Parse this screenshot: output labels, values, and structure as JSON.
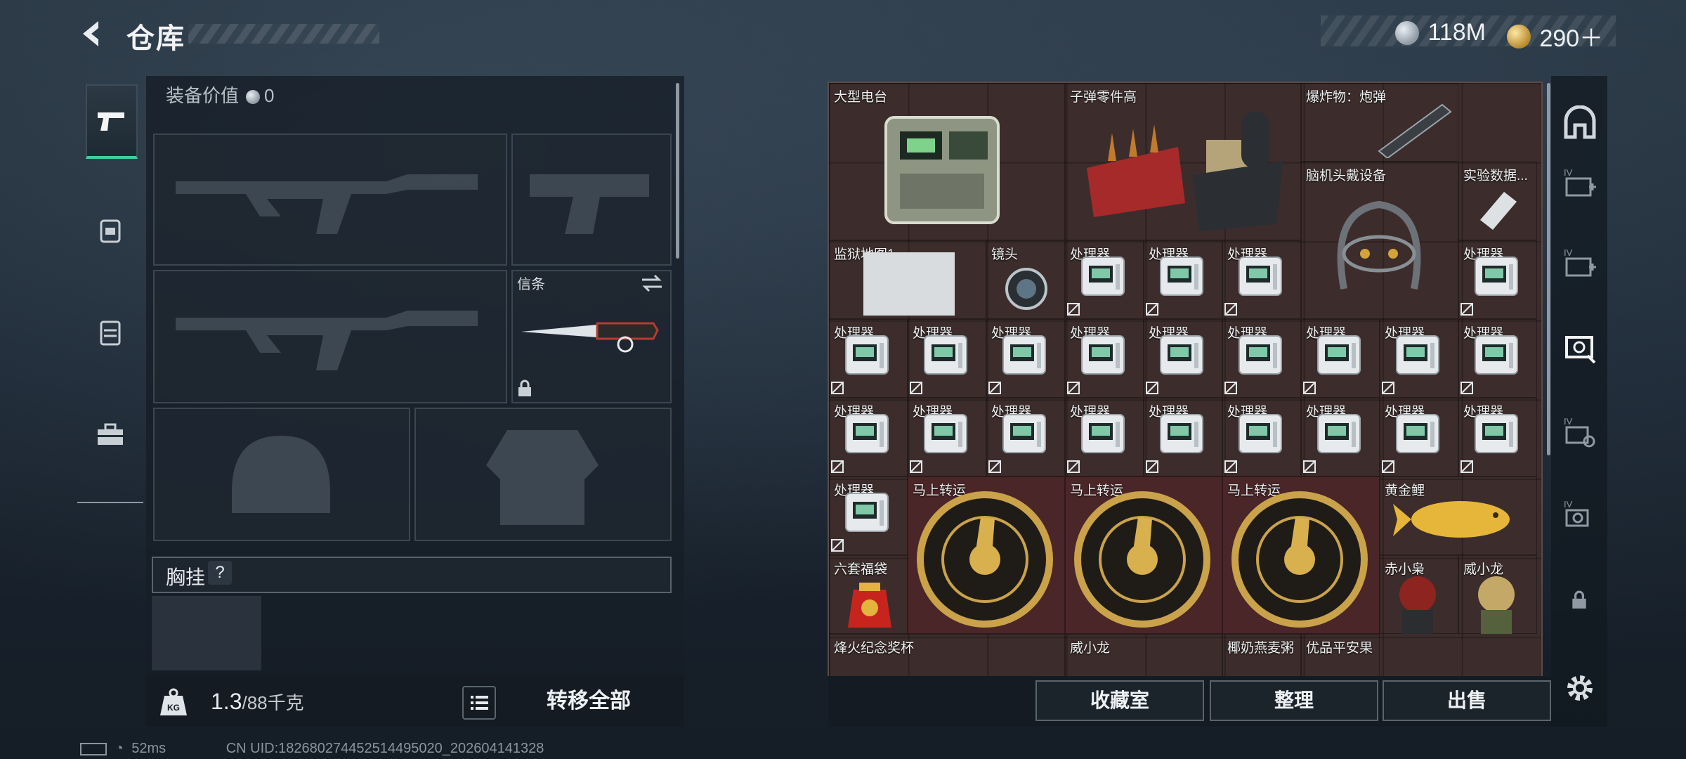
{
  "header": {
    "title": "仓库",
    "currency_silver": "118M",
    "currency_gold": "290＋"
  },
  "left_panel": {
    "equipment_value_label": "装备价值",
    "equipment_value": "0",
    "knife_slot_label": "信条",
    "chest_rig_label": "胸挂",
    "chest_rig_help": "?",
    "weight_value": "1.3",
    "weight_capacity": "/88千克",
    "transfer_all": "转移全部"
  },
  "status_bar": {
    "ping": "52ms",
    "uid": "CN UID:18268027445251449502​0_202604141328"
  },
  "grid_items": {
    "big_radio": "大型电台",
    "bullet_parts": "子弹零件高",
    "explosive": "爆炸物：炮弹",
    "brain_headset": "脑机头戴设备",
    "experiment_data": "实验数据...",
    "prison_map": "监狱地图1",
    "lens": "镜头",
    "processor": "处理器",
    "horse_1": "马上转运",
    "horse_2": "马上转运",
    "horse_3": "马上转运",
    "golden_carp": "黄金鲤",
    "lucky_bag": "六套福袋",
    "chixiao": "赤小枭",
    "weixiaolong_1": "威小龙",
    "trophy": "烽火纪念奖杯",
    "weixiaolong_2": "威小龙",
    "oat_porridge": "椰奶燕麦粥",
    "peace_apple": "优品平安果"
  },
  "bottom_actions": {
    "collection_room": "收藏室",
    "organize": "整理",
    "sell": "出售"
  },
  "colors": {
    "accent_green": "#3fcf9c",
    "grid_brown": "#3c2d2c",
    "grid_red": "#4a2628"
  }
}
